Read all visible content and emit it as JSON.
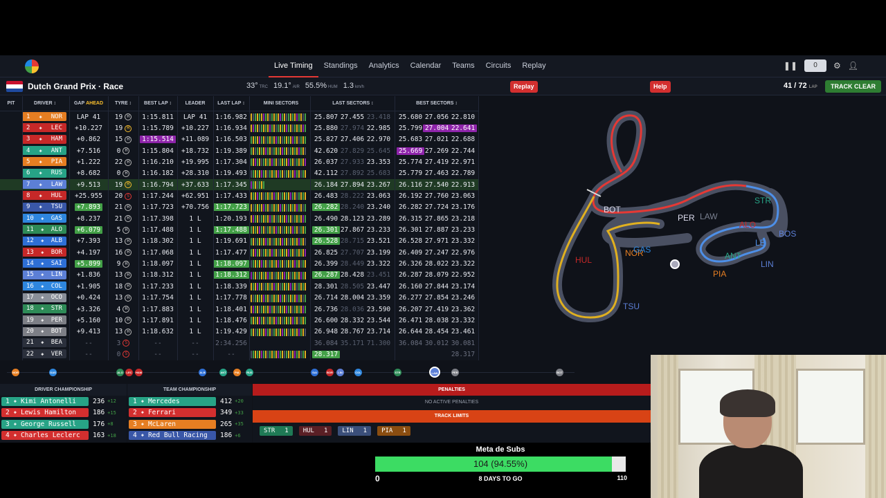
{
  "nav": {
    "links": [
      "Live Timing",
      "Standings",
      "Analytics",
      "Calendar",
      "Teams",
      "Circuits",
      "Replay"
    ],
    "pause_count": "0"
  },
  "session": {
    "title": "Dutch Grand Prix · Race",
    "track_temp": "33°",
    "track_temp_unit": "TRC",
    "air_temp": "19.1°",
    "air_temp_unit": "AIR",
    "humidity": "55.5%",
    "humidity_unit": "HUM",
    "wind": "1.3",
    "wind_unit": "km/h",
    "replay_btn": "Replay",
    "help_btn": "Help",
    "lap": "41 / 72",
    "lap_unit": "LAP",
    "track_status": "TRACK CLEAR"
  },
  "table": {
    "headers": {
      "pit": "PIT",
      "driver": "DRIVER ↕",
      "gap": "GAP",
      "gap_mode": "AHEAD",
      "tyre": "TYRE ↕",
      "best_lap": "BEST LAP ↕",
      "leader": "LEADER",
      "last_lap": "LAST LAP ↕",
      "mini_sectors": "MINI SECTORS",
      "last_sectors": "LAST SECTORS ↕",
      "best_sectors": "BEST SECTORS ↕"
    },
    "rows": [
      {
        "pos": "1",
        "code": "NOR",
        "team": "mclaren",
        "gap": "LAP 41",
        "laps": "19",
        "tyre": "H",
        "best": "1:15.811",
        "leader": "LAP 41",
        "last": "1:16.982",
        "ls": [
          "25.807",
          "27.455",
          "23.418"
        ],
        "bs": [
          "25.680",
          "27.056",
          "22.810"
        ]
      },
      {
        "pos": "2",
        "code": "LEC",
        "team": "ferrari",
        "gap": "+10.227",
        "laps": "19",
        "tyre": "M",
        "best": "1:15.789",
        "leader": "+10.227",
        "last": "1:16.934",
        "ls": [
          "25.880",
          "27.974",
          "22.985"
        ],
        "bs": [
          "25.799",
          "27.004",
          "22.641"
        ],
        "bsp": [
          1,
          2
        ]
      },
      {
        "pos": "3",
        "code": "HAM",
        "team": "ferrari",
        "gap": "+0.862",
        "laps": "15",
        "tyre": "H",
        "best": "1:15.514",
        "bestp": true,
        "leader": "+11.089",
        "last": "1:16.503",
        "ls": [
          "25.827",
          "27.406",
          "22.970"
        ],
        "bs": [
          "25.683",
          "27.021",
          "22.688"
        ]
      },
      {
        "pos": "4",
        "code": "ANT",
        "team": "mercedes",
        "gap": "+7.516",
        "laps": "0",
        "tyre": "H",
        "best": "1:15.804",
        "leader": "+18.732",
        "last": "1:19.389",
        "ls": [
          "42.620",
          "27.829",
          "25.645"
        ],
        "bs": [
          "25.669",
          "27.269",
          "22.744"
        ],
        "bsp": [
          0
        ]
      },
      {
        "pos": "5",
        "code": "PIA",
        "team": "mclaren",
        "gap": "+1.222",
        "laps": "22",
        "tyre": "H",
        "best": "1:16.210",
        "leader": "+19.995",
        "last": "1:17.304",
        "ls": [
          "26.037",
          "27.933",
          "23.353"
        ],
        "bs": [
          "25.774",
          "27.419",
          "22.971"
        ]
      },
      {
        "pos": "6",
        "code": "RUS",
        "team": "mercedes",
        "gap": "+8.682",
        "laps": "0",
        "tyre": "H",
        "best": "1:16.182",
        "leader": "+28.310",
        "last": "1:19.493",
        "ls": [
          "42.112",
          "27.892",
          "25.683"
        ],
        "bs": [
          "25.779",
          "27.463",
          "22.789"
        ]
      },
      {
        "pos": "7",
        "code": "LAW",
        "team": "rb",
        "gap": "+9.513",
        "laps": "19",
        "tyre": "M",
        "best": "1:16.794",
        "leader": "+37.633",
        "last": "1:17.345",
        "ls": [
          "26.184",
          "27.894",
          "23.267"
        ],
        "bs": [
          "26.116",
          "27.540",
          "22.913"
        ],
        "sel": true
      },
      {
        "pos": "8",
        "code": "HUL",
        "team": "sauber",
        "gap": "+25.955",
        "laps": "20",
        "tyre": "S",
        "best": "1:17.244",
        "leader": "+62.951",
        "last": "1:17.433",
        "ls": [
          "26.483",
          "28.222",
          "23.063"
        ],
        "bs": [
          "26.192",
          "27.760",
          "23.063"
        ]
      },
      {
        "pos": "9",
        "code": "TSU",
        "team": "redbull",
        "gap": "+7.893",
        "gapg": true,
        "laps": "21",
        "tyre": "H",
        "best": "1:17.723",
        "leader": "+70.756",
        "last": "1:17.723",
        "lastg": true,
        "ls": [
          "26.282",
          "28.240",
          "23.240"
        ],
        "lsg": [
          0
        ],
        "bs": [
          "26.282",
          "27.724",
          "23.176"
        ]
      },
      {
        "pos": "10",
        "code": "GAS",
        "team": "alpine",
        "gap": "+8.237",
        "laps": "21",
        "tyre": "H",
        "best": "1:17.398",
        "leader": "1 L",
        "last": "1:20.193",
        "ls": [
          "26.490",
          "28.123",
          "23.289"
        ],
        "bs": [
          "26.315",
          "27.865",
          "23.218"
        ]
      },
      {
        "pos": "11",
        "code": "ALO",
        "team": "aston",
        "gap": "+6.079",
        "gapg": true,
        "laps": "5",
        "tyre": "H",
        "best": "1:17.488",
        "leader": "1 L",
        "last": "1:17.488",
        "lastg": true,
        "ls": [
          "26.301",
          "27.867",
          "23.233"
        ],
        "lsg": [
          0
        ],
        "bs": [
          "26.301",
          "27.887",
          "23.233"
        ]
      },
      {
        "pos": "12",
        "code": "ALB",
        "team": "williams",
        "gap": "+7.393",
        "laps": "13",
        "tyre": "H",
        "best": "1:18.302",
        "leader": "1 L",
        "last": "1:19.691",
        "ls": [
          "26.528",
          "28.715",
          "23.521"
        ],
        "lsg": [
          0
        ],
        "bs": [
          "26.528",
          "27.971",
          "23.332"
        ]
      },
      {
        "pos": "13",
        "code": "BOR",
        "team": "sauber",
        "gap": "+4.197",
        "laps": "16",
        "tyre": "H",
        "best": "1:17.068",
        "leader": "1 L",
        "last": "1:17.477",
        "ls": [
          "26.825",
          "27.707",
          "23.199"
        ],
        "bs": [
          "26.409",
          "27.247",
          "22.976"
        ]
      },
      {
        "pos": "14",
        "code": "SAI",
        "team": "williams",
        "gap": "+5.899",
        "gapg": true,
        "laps": "9",
        "tyre": "H",
        "best": "1:18.097",
        "leader": "1 L",
        "last": "1:18.097",
        "lastg": true,
        "ls": [
          "26.399",
          "28.449",
          "23.322"
        ],
        "bs": [
          "26.326",
          "28.022",
          "23.322"
        ]
      },
      {
        "pos": "15",
        "code": "LIN",
        "team": "rb",
        "gap": "+1.836",
        "laps": "13",
        "tyre": "H",
        "best": "1:18.312",
        "leader": "1 L",
        "last": "1:18.312",
        "lastg": true,
        "ls": [
          "26.287",
          "28.428",
          "23.451"
        ],
        "lsg": [
          0
        ],
        "bs": [
          "26.287",
          "28.079",
          "22.952"
        ]
      },
      {
        "pos": "16",
        "code": "COL",
        "team": "alpine",
        "gap": "+1.905",
        "laps": "18",
        "tyre": "H",
        "best": "1:17.233",
        "leader": "1 L",
        "last": "1:18.339",
        "ls": [
          "28.301",
          "28.505",
          "23.447"
        ],
        "bs": [
          "26.160",
          "27.844",
          "23.174"
        ]
      },
      {
        "pos": "17",
        "code": "OCO",
        "team": "haas",
        "gap": "+0.424",
        "laps": "13",
        "tyre": "H",
        "best": "1:17.754",
        "leader": "1 L",
        "last": "1:17.778",
        "ls": [
          "26.714",
          "28.004",
          "23.359"
        ],
        "bs": [
          "26.277",
          "27.854",
          "23.246"
        ]
      },
      {
        "pos": "18",
        "code": "STR",
        "team": "aston",
        "gap": "+3.326",
        "laps": "4",
        "tyre": "H",
        "best": "1:17.883",
        "leader": "1 L",
        "last": "1:18.401",
        "ls": [
          "26.736",
          "28.036",
          "23.590"
        ],
        "bs": [
          "26.207",
          "27.419",
          "23.362"
        ]
      },
      {
        "pos": "19",
        "code": "PER",
        "team": "cadillac",
        "gap": "+5.160",
        "laps": "10",
        "tyre": "H",
        "best": "1:17.891",
        "leader": "1 L",
        "last": "1:18.476",
        "ls": [
          "26.600",
          "28.332",
          "23.544"
        ],
        "bs": [
          "26.471",
          "28.038",
          "23.332"
        ]
      },
      {
        "pos": "20",
        "code": "BOT",
        "team": "cadillac",
        "gap": "+9.413",
        "laps": "13",
        "tyre": "H",
        "best": "1:18.632",
        "leader": "1 L",
        "last": "1:19.429",
        "ls": [
          "26.948",
          "28.767",
          "23.714"
        ],
        "bs": [
          "26.644",
          "28.454",
          "23.461"
        ]
      },
      {
        "pos": "21",
        "code": "BEA",
        "team": "haas",
        "gap": "--",
        "laps": "3",
        "tyre": "S",
        "best": "--",
        "leader": "--",
        "last": "2:34.256",
        "ls": [
          "36.084",
          "35.171",
          "71.300"
        ],
        "bs": [
          "36.084",
          "30.012",
          "30.081"
        ],
        "faded": true
      },
      {
        "pos": "22",
        "code": "VER",
        "team": "redbull",
        "gap": "--",
        "laps": "0",
        "tyre": "S",
        "best": "--",
        "leader": "--",
        "last": "--",
        "ls": [
          "28.317",
          "",
          ""
        ],
        "lsg": [
          0
        ],
        "bs": [
          "",
          "",
          "28.317"
        ],
        "faded": true
      }
    ]
  },
  "strip": [
    "NOR",
    "GAS",
    "ALO",
    "LEC",
    "HAM",
    "ALB",
    "ANT",
    "PIA",
    "RUS",
    "SAI",
    "BOR",
    "LIN",
    "COL",
    "STR",
    "LAW",
    "PER",
    "BOT"
  ],
  "driver_championship": {
    "title": "DRIVER CHAMPIONSHIP",
    "rows": [
      {
        "pos": "1",
        "name": "Kimi Antonelli",
        "pts": "236",
        "delta": "+12",
        "color": "#27a386"
      },
      {
        "pos": "2",
        "name": "Lewis Hamilton",
        "pts": "186",
        "delta": "+15",
        "color": "#d32f2f"
      },
      {
        "pos": "3",
        "name": "George Russell",
        "pts": "176",
        "delta": "+8",
        "color": "#27a386"
      },
      {
        "pos": "4",
        "name": "Charles Leclerc",
        "pts": "163",
        "delta": "+18",
        "color": "#d32f2f"
      }
    ]
  },
  "team_championship": {
    "title": "TEAM CHAMPIONSHIP",
    "rows": [
      {
        "pos": "1",
        "name": "Mercedes",
        "pts": "412",
        "delta": "+20",
        "color": "#27a386"
      },
      {
        "pos": "2",
        "name": "Ferrari",
        "pts": "349",
        "delta": "+33",
        "color": "#d32f2f"
      },
      {
        "pos": "3",
        "name": "McLaren",
        "pts": "265",
        "delta": "+35",
        "color": "#e67e22"
      },
      {
        "pos": "4",
        "name": "Red Bull Racing",
        "pts": "186",
        "delta": "+6",
        "color": "#3957a8"
      }
    ]
  },
  "penalties": {
    "title": "PENALTIES",
    "empty": "NO ACTIVE PENALTIES",
    "track_limits_title": "TRACK LIMITS",
    "track_limits": [
      {
        "code": "STR",
        "count": "1",
        "color": "#1f7a55"
      },
      {
        "code": "HUL",
        "count": "1",
        "color": "#5a1f25"
      },
      {
        "code": "LIN",
        "count": "1",
        "color": "#3b4f7a"
      },
      {
        "code": "PIA",
        "count": "1",
        "color": "#8a4d10"
      }
    ]
  },
  "map_labels": [
    "BOT",
    "PER",
    "LAW",
    "STR",
    "ALO",
    "LB",
    "BOS",
    "ANT",
    "LIN",
    "PIA",
    "HUL",
    "NOR",
    "GAS",
    "TSU"
  ],
  "sub_goal": {
    "title": "Meta de Subs",
    "value": "104 (94.55%)",
    "progress": 0.9455,
    "start": "0",
    "end": "110",
    "days": "8 DAYS TO GO"
  },
  "colors": {
    "mclaren": "#e67e22",
    "ferrari": "#c62828",
    "mercedes": "#27a386",
    "redbull": "#3957a8",
    "rb": "#5c7fd6",
    "sauber": "#c62828",
    "alpine": "#2e86de",
    "aston": "#2e8b57",
    "williams": "#2e6fd6",
    "haas": "#8a8f99",
    "cadillac": "#7d7f86",
    "accent_red": "#d32f2f",
    "purple": "#8e24aa",
    "green": "#43a047"
  }
}
